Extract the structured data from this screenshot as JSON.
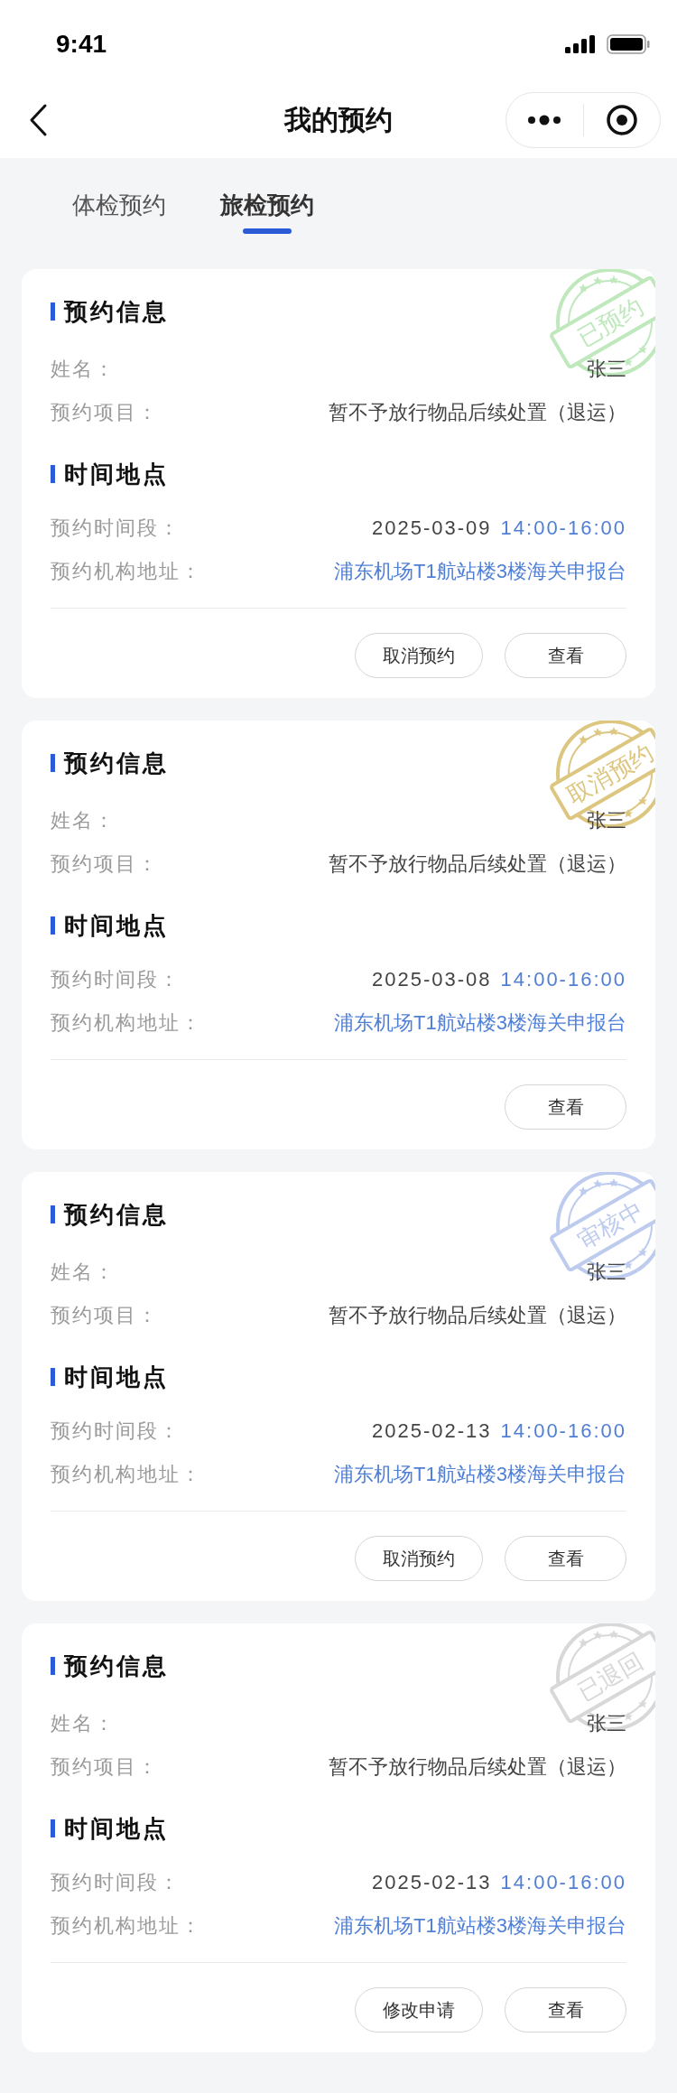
{
  "status_bar": {
    "time": "9:41"
  },
  "nav": {
    "title": "我的预约"
  },
  "tabs": [
    {
      "label": "体检预约",
      "selected": false
    },
    {
      "label": "旅检预约",
      "selected": true
    }
  ],
  "cards": [
    {
      "stamp": {
        "text": "已预约",
        "color": "#bfe8bc"
      },
      "sections": [
        {
          "title": "预约信息",
          "rows": [
            {
              "kind": "text",
              "label": "姓名：",
              "value": "张三"
            },
            {
              "kind": "text",
              "label": "预约项目：",
              "value": "暂不予放行物品后续处置（退运）"
            }
          ]
        },
        {
          "title": "时间地点",
          "rows": [
            {
              "kind": "datetime",
              "label": "预约时间段：",
              "date": "2025-03-09",
              "time": "14:00-16:00"
            },
            {
              "kind": "link",
              "label": "预约机构地址：",
              "value": "浦东机场T1航站楼3楼海关申报台"
            }
          ]
        }
      ],
      "buttons": [
        "取消预约",
        "查看"
      ]
    },
    {
      "stamp": {
        "text": "取消预约",
        "color": "#dcc680"
      },
      "sections": [
        {
          "title": "预约信息",
          "rows": [
            {
              "kind": "text",
              "label": "姓名：",
              "value": "张三"
            },
            {
              "kind": "text",
              "label": "预约项目：",
              "value": "暂不予放行物品后续处置（退运）"
            }
          ]
        },
        {
          "title": "时间地点",
          "rows": [
            {
              "kind": "datetime",
              "label": "预约时间段：",
              "date": "2025-03-08",
              "time": "14:00-16:00"
            },
            {
              "kind": "link",
              "label": "预约机构地址：",
              "value": "浦东机场T1航站楼3楼海关申报台"
            }
          ]
        }
      ],
      "buttons": [
        "查看"
      ]
    },
    {
      "stamp": {
        "text": "审核中",
        "color": "#bccbee"
      },
      "sections": [
        {
          "title": "预约信息",
          "rows": [
            {
              "kind": "text",
              "label": "姓名：",
              "value": "张三"
            },
            {
              "kind": "text",
              "label": "预约项目：",
              "value": "暂不予放行物品后续处置（退运）"
            }
          ]
        },
        {
          "title": "时间地点",
          "rows": [
            {
              "kind": "datetime",
              "label": "预约时间段：",
              "date": "2025-02-13",
              "time": "14:00-16:00"
            },
            {
              "kind": "link",
              "label": "预约机构地址：",
              "value": "浦东机场T1航站楼3楼海关申报台"
            }
          ]
        }
      ],
      "buttons": [
        "取消预约",
        "查看"
      ]
    },
    {
      "stamp": {
        "text": "已退回",
        "color": "#d8d8d8"
      },
      "sections": [
        {
          "title": "预约信息",
          "rows": [
            {
              "kind": "text",
              "label": "姓名：",
              "value": "张三"
            },
            {
              "kind": "text",
              "label": "预约项目：",
              "value": "暂不予放行物品后续处置（退运）"
            }
          ]
        },
        {
          "title": "时间地点",
          "rows": [
            {
              "kind": "datetime",
              "label": "预约时间段：",
              "date": "2025-02-13",
              "time": "14:00-16:00"
            },
            {
              "kind": "link",
              "label": "预约机构地址：",
              "value": "浦东机场T1航站楼3楼海关申报台"
            }
          ]
        }
      ],
      "buttons": [
        "修改申请",
        "查看"
      ]
    }
  ]
}
